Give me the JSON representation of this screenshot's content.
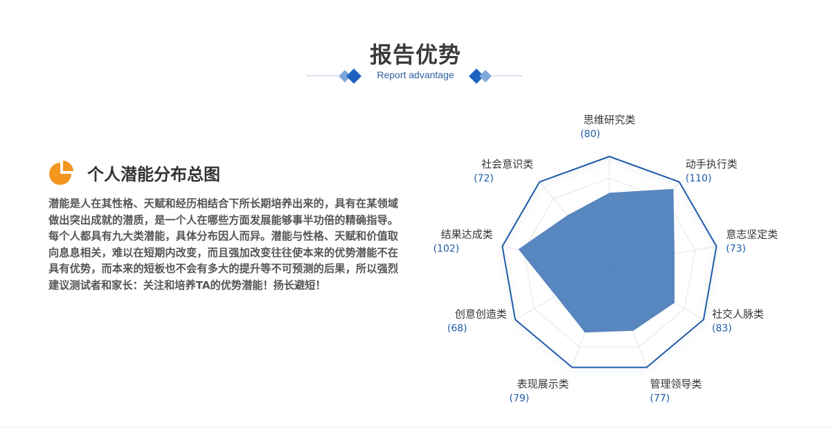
{
  "header": {
    "title": "报告优势",
    "subtitle": "Report advantage"
  },
  "section": {
    "title": "个人潜能分布总图",
    "body": "潜能是人在其性格、天赋和经历相结合下所长期培养出来的，具有在某领域做出突出成就的潜质，是一个人在哪些方面发展能够事半功倍的精确指导。每个人都具有九大类潜能，具体分布因人而异。潜能与性格、天赋和价值取向息息相关，难以在短期内改变，而且强加改变往往使本来的优势潜能不在具有优势，而本来的短板也不会有多大的提升等不可预测的后果，所以强烈建议测试者和家长：关注和培养TA的优势潜能！扬长避短！",
    "icon": "pie-chart-icon"
  },
  "colors": {
    "accent": "#f3951f",
    "brand_blue": "#1d5aa8",
    "radar_fill": "#4f7fba",
    "title_text": "#3a3a3a"
  },
  "chart_data": {
    "type": "radar",
    "categories": [
      "思维研究类",
      "动手执行类",
      "意志坚定类",
      "社交人脉类",
      "管理领导类",
      "表现展示类",
      "创意创造类",
      "结果达成类",
      "社会意识类"
    ],
    "values": [
      80,
      110,
      73,
      83,
      77,
      79,
      68,
      102,
      72
    ],
    "value_labels": [
      "(80)",
      "(110)",
      "(73)",
      "(83)",
      "(77)",
      "(79)",
      "(68)",
      "(102)",
      "(72)"
    ],
    "max": 120,
    "grid_levels": 5,
    "legend": "none"
  }
}
